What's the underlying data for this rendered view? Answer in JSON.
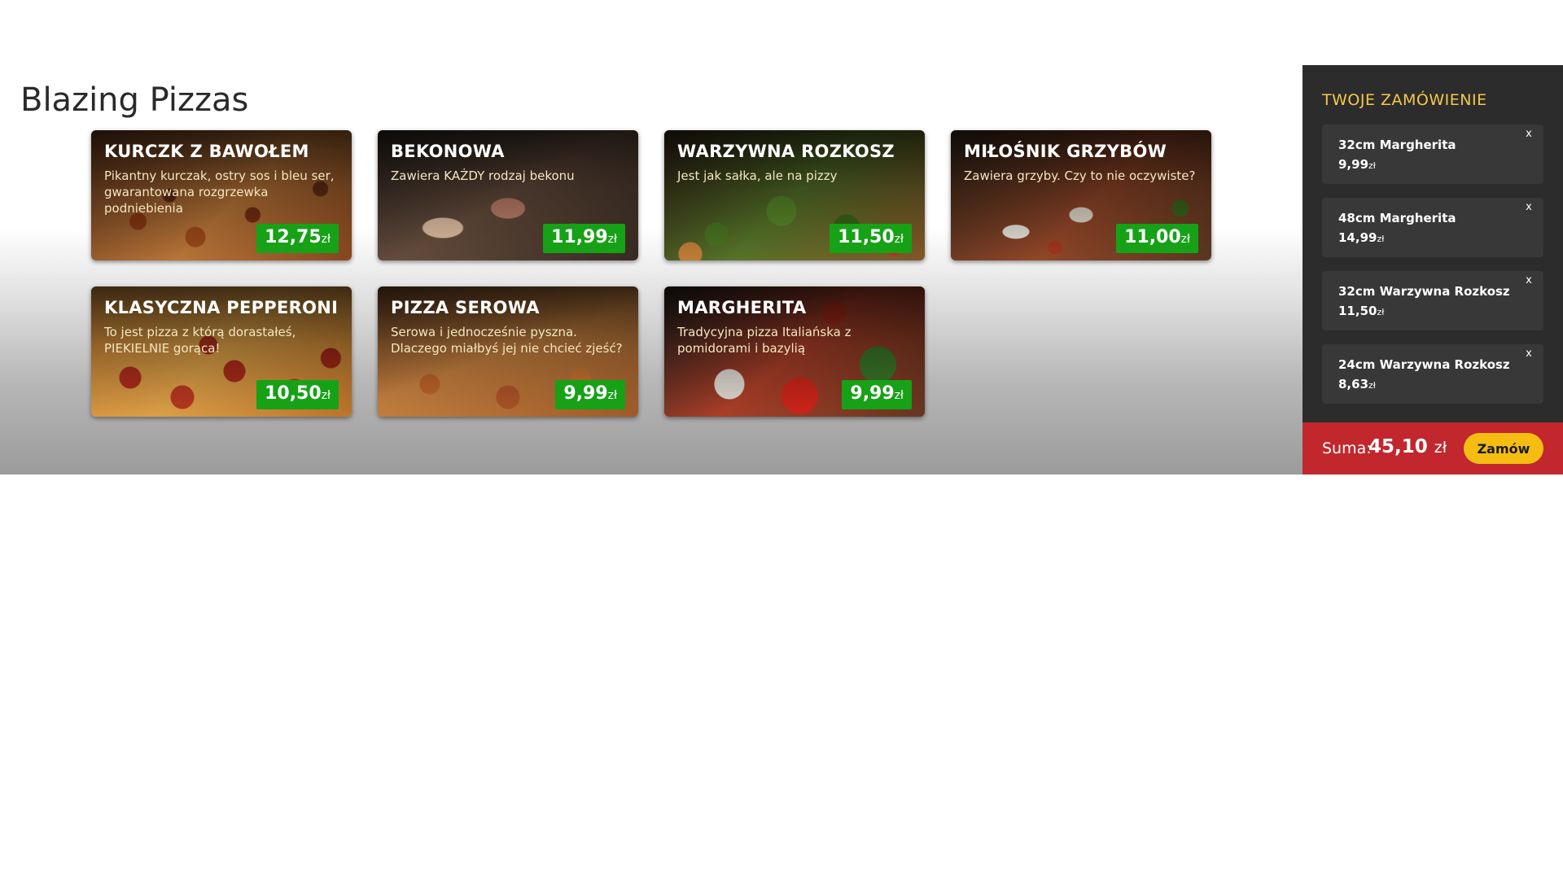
{
  "page": {
    "title": "Blazing Pizzas"
  },
  "menu": {
    "pizzas": [
      {
        "name": "KURCZK Z BAWOŁEM",
        "description": "Pikantny kurczak, ostry sos i bleu ser, gwarantowana rozgrzewka podniebienia",
        "price": "12,75",
        "currency": "zł",
        "image": "chicken-pizza"
      },
      {
        "name": "BEKONOWA",
        "description": "Zawiera KAŻDY rodzaj bekonu",
        "price": "11,99",
        "currency": "zł",
        "image": "bacon-pizza"
      },
      {
        "name": "WARZYWNA ROZKOSZ",
        "description": "Jest jak sałka, ale na pizzy",
        "price": "11,50",
        "currency": "zł",
        "image": "veggie-pizza"
      },
      {
        "name": "MIŁOŚNIK GRZYBÓW",
        "description": "Zawiera grzyby. Czy to nie oczywiste?",
        "price": "11,00",
        "currency": "zł",
        "image": "mushroom-pizza"
      },
      {
        "name": "KLASYCZNA PEPPERONI",
        "description": "To jest pizza z którą dorastałeś, PIEKIELNIE gorąca!",
        "price": "10,50",
        "currency": "zł",
        "image": "pepperoni-pizza"
      },
      {
        "name": "PIZZA SEROWA",
        "description": "Serowa i jednocześnie pyszna. Dlaczego miałbyś jej nie chcieć zjeść?",
        "price": "9,99",
        "currency": "zł",
        "image": "cheese-pizza"
      },
      {
        "name": "MARGHERITA",
        "description": "Tradycyjna pizza Italiańska z pomidorami i bazylią",
        "price": "9,99",
        "currency": "zł",
        "image": "margherita-pizza"
      }
    ]
  },
  "sidebar": {
    "title": "TWOJE ZAMÓWIENIE",
    "items": [
      {
        "name": "32cm Margherita",
        "price": "9,99",
        "currency": "zł",
        "remove_label": "x"
      },
      {
        "name": "48cm Margherita",
        "price": "14,99",
        "currency": "zł",
        "remove_label": "x"
      },
      {
        "name": "32cm Warzywna Rozkosz",
        "price": "11,50",
        "currency": "zł",
        "remove_label": "x"
      },
      {
        "name": "24cm Warzywna Rozkosz",
        "price": "8,63",
        "currency": "zł",
        "remove_label": "x"
      }
    ],
    "total_label": "Suma:",
    "total_value": "45,10",
    "total_currency": "zł",
    "order_button": "Zamów"
  },
  "colors": {
    "price_badge": "#17a117",
    "sidebar_bg": "#2c2c2c",
    "sidebar_title": "#f5c84a",
    "total_bar": "#c1272d",
    "order_button": "#f5bd12"
  }
}
